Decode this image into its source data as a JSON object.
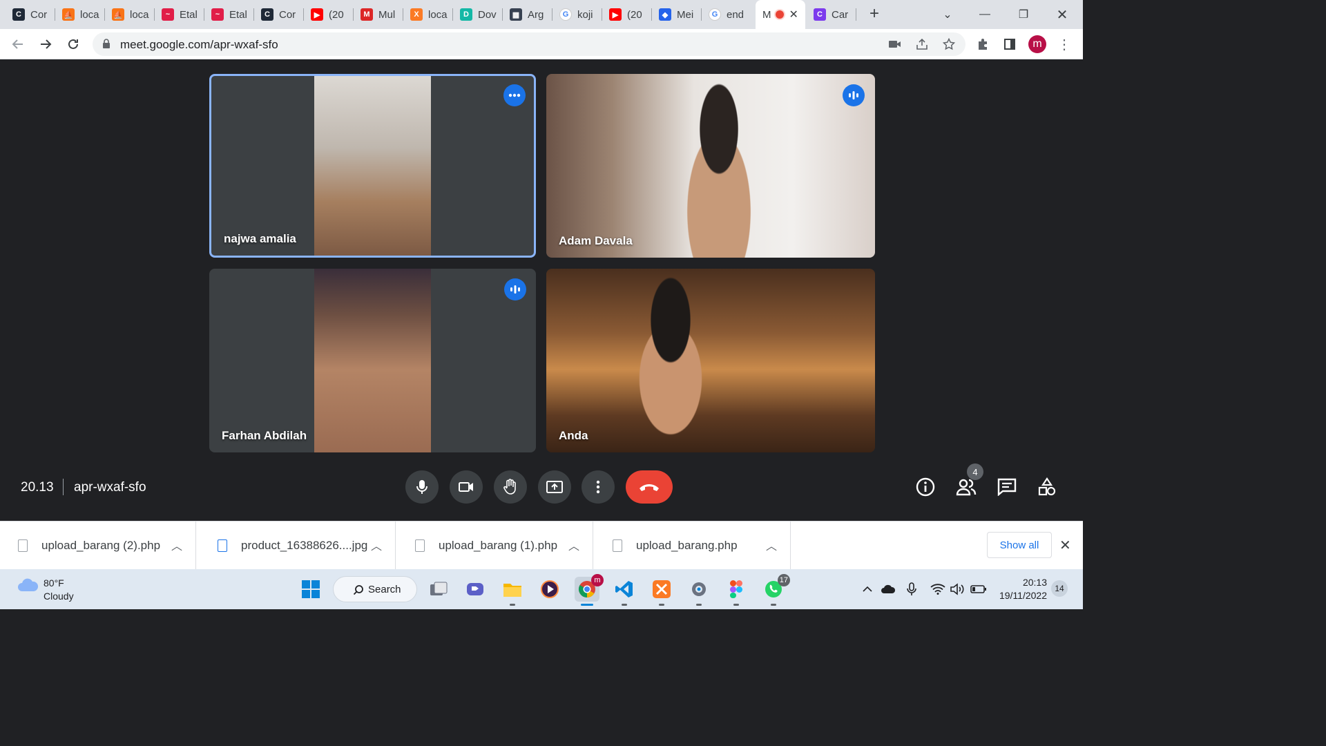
{
  "browser": {
    "tabs": [
      {
        "label": "Cor",
        "icon": "codesandbox-icon",
        "color": "#1f2937"
      },
      {
        "label": "loca",
        "icon": "xampp-sail-icon",
        "color": "#f97316"
      },
      {
        "label": "loca",
        "icon": "xampp-sail-icon",
        "color": "#f97316"
      },
      {
        "label": "Etal",
        "icon": "etalase-icon",
        "color": "#e11d48"
      },
      {
        "label": "Etal",
        "icon": "etalase-icon",
        "color": "#e11d48"
      },
      {
        "label": "Cor",
        "icon": "codesandbox-icon",
        "color": "#1f2937"
      },
      {
        "label": "(20",
        "icon": "youtube-icon",
        "color": "#ff0000"
      },
      {
        "label": "Mul",
        "icon": "mul-icon",
        "color": "#dc2626"
      },
      {
        "label": "loca",
        "icon": "xampp-icon",
        "color": "#fb7a24"
      },
      {
        "label": "Dov",
        "icon": "dov-icon",
        "color": "#14b8a6"
      },
      {
        "label": "Arg",
        "icon": "arg-icon",
        "color": "#374151"
      },
      {
        "label": "koji",
        "icon": "google-icon",
        "color": "#4285f4"
      },
      {
        "label": "(20",
        "icon": "youtube-icon",
        "color": "#ff0000"
      },
      {
        "label": "Mei",
        "icon": "meet-app-icon",
        "color": "#2563eb"
      },
      {
        "label": "end",
        "icon": "google-icon",
        "color": "#4285f4"
      },
      {
        "label": "M",
        "icon": "recording-dot-icon",
        "color": "#ea4335",
        "active": true
      },
      {
        "label": "Car",
        "icon": "canva-icon",
        "color": "#7c3aed"
      }
    ],
    "url": "meet.google.com/apr-wxaf-sfo",
    "profile_initial": "m"
  },
  "meet": {
    "participants": [
      {
        "name": "najwa amalia",
        "badge": "more-options-icon",
        "pinned": true
      },
      {
        "name": "Adam Davala",
        "badge": "speaking-icon"
      },
      {
        "name": "Farhan Abdilah",
        "badge": "speaking-icon"
      },
      {
        "name": "Anda",
        "badge": ""
      }
    ],
    "time": "20.13",
    "meeting_code": "apr-wxaf-sfo",
    "participant_count": "4",
    "accent": "#1a73e8",
    "end_call_color": "#ea4335"
  },
  "downloads": {
    "items": [
      {
        "name": "upload_barang (2).php"
      },
      {
        "name": "product_16388626....jpg"
      },
      {
        "name": "upload_barang (1).php"
      },
      {
        "name": "upload_barang.php"
      }
    ],
    "show_all": "Show all"
  },
  "taskbar": {
    "weather_temp": "80°F",
    "weather_condition": "Cloudy",
    "search_label": "Search",
    "chrome_badge": "m",
    "whatsapp_badge": "17",
    "time": "20:13",
    "date": "19/11/2022",
    "notifications": "14"
  }
}
